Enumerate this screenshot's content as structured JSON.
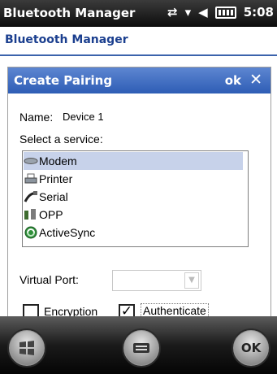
{
  "titlebar": {
    "title": "Bluetooth Manager",
    "time": "5:08"
  },
  "header": {
    "title": "Bluetooth Manager"
  },
  "dialog": {
    "title": "Create Pairing",
    "ok_label": "ok",
    "close_label": "✕",
    "name_label": "Name:",
    "name_value": "Device 1",
    "service_label": "Select a service:",
    "services": [
      "Modem",
      "Printer",
      "Serial",
      "OPP",
      "ActiveSync"
    ],
    "selected_service": "Modem",
    "virtual_port_label": "Virtual Port:",
    "encryption_label": "Encryption",
    "encryption_checked": false,
    "authenticate_label": "Authenticate",
    "authenticate_checked": true
  },
  "softbar": {
    "ok_label": "OK"
  },
  "colors": {
    "dialog_title_bg": "#2e5db5",
    "header_text": "#1b3f8f",
    "selection": "#c7d2ea"
  }
}
